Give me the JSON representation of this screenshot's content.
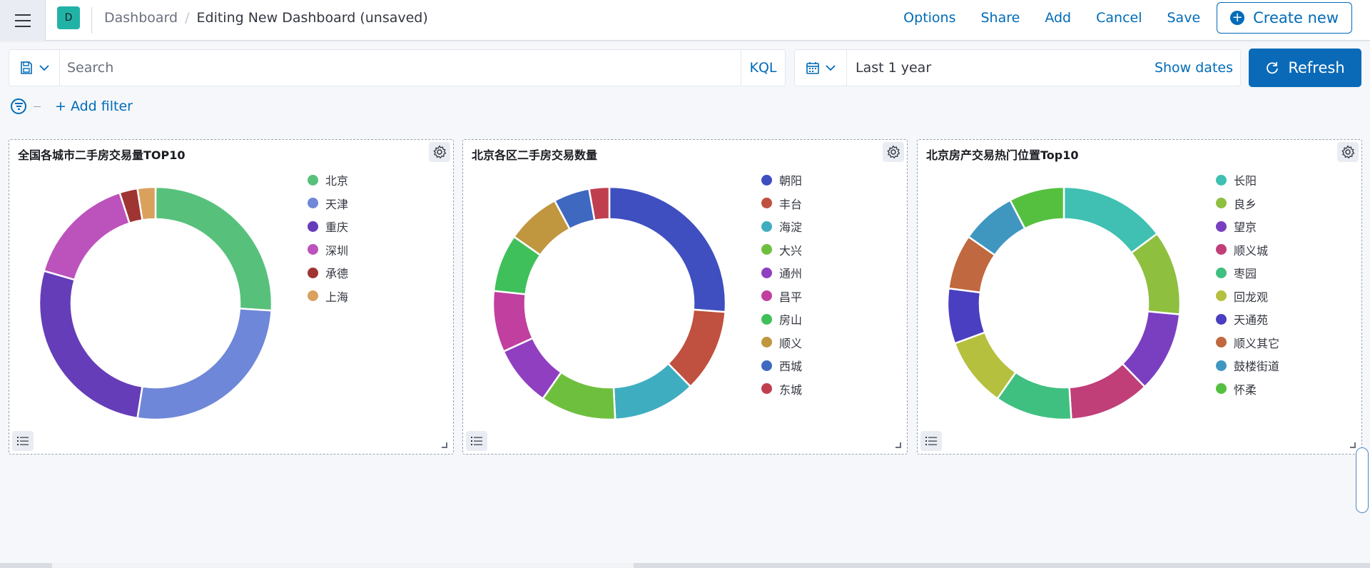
{
  "header": {
    "space_initial": "D",
    "breadcrumb_root": "Dashboard",
    "breadcrumb_separator": "/",
    "breadcrumb_current": "Editing New Dashboard (unsaved)",
    "actions": [
      "Options",
      "Share",
      "Add",
      "Cancel",
      "Save"
    ],
    "create_new_label": "Create new"
  },
  "query": {
    "search_placeholder": "Search",
    "kql_label": "KQL",
    "date_range": "Last 1 year",
    "show_dates_label": "Show dates",
    "refresh_label": "Refresh",
    "add_filter_label": "+ Add filter"
  },
  "panels": [
    {
      "title": "全国各城市二手房交易量TOP10",
      "chart_data": {
        "type": "pie",
        "title": "全国各城市二手房交易量TOP10",
        "labels": [
          "北京",
          "天津",
          "重庆",
          "深圳",
          "承德",
          "上海"
        ],
        "values": [
          26.0,
          26.5,
          27.0,
          15.5,
          2.5,
          2.5
        ],
        "colors": [
          "#57c17b",
          "#6f87d8",
          "#663db8",
          "#bc52bc",
          "#9e3533",
          "#daa05d"
        ]
      }
    },
    {
      "title": "北京各区二手房交易数量",
      "chart_data": {
        "type": "pie",
        "title": "北京各区二手房交易数量",
        "labels": [
          "朝阳",
          "丰台",
          "海淀",
          "大兴",
          "通州",
          "昌平",
          "房山",
          "顺义",
          "西城",
          "东城"
        ],
        "values": [
          26.2,
          11.5,
          11.5,
          10.5,
          8.5,
          8.5,
          8.0,
          7.5,
          5.0,
          2.8
        ],
        "colors": [
          "#3f4fc0",
          "#c0503f",
          "#3fadc0",
          "#6fbf3f",
          "#8f3fc0",
          "#c03f9f",
          "#3fc05a",
          "#c0963f",
          "#3f68c0",
          "#c03f4f"
        ]
      }
    },
    {
      "title": "北京房产交易热门位置Top10",
      "chart_data": {
        "type": "pie",
        "title": "北京房产交易热门位置Top10",
        "labels": [
          "长阳",
          "良乡",
          "望京",
          "顺义城",
          "枣园",
          "回龙观",
          "天通苑",
          "顺义其它",
          "鼓楼街道",
          "怀柔"
        ],
        "values": [
          14.5,
          11.5,
          11.0,
          11.0,
          10.5,
          9.5,
          7.5,
          7.5,
          7.5,
          7.5
        ],
        "colors": [
          "#3fc0b2",
          "#8fbf3f",
          "#7a3fc0",
          "#c03f78",
          "#3fc080",
          "#b5c03f",
          "#4a3fc0",
          "#c0683f",
          "#3f97c0",
          "#55c03f"
        ]
      }
    }
  ],
  "icons": {
    "menu": "hamburger-icon",
    "saved_query": "save-icon",
    "calendar": "calendar-icon",
    "refresh": "refresh-icon",
    "filter": "filter-icon",
    "panel_options": "gear-icon",
    "legend": "list-icon"
  },
  "colors": {
    "accent": "#006bb8",
    "refresh_button": "#0a6ab8",
    "background": "#f5f7fa"
  }
}
